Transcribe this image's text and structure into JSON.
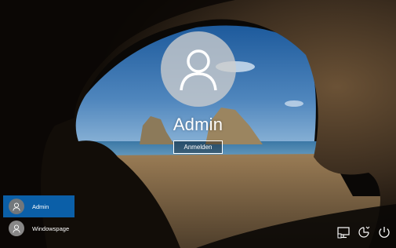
{
  "user": {
    "name": "Admin",
    "sign_in_label": "Anmelden"
  },
  "user_list": [
    {
      "name": "Admin",
      "selected": true
    },
    {
      "name": "Windowspage",
      "selected": false
    }
  ],
  "system_icons": [
    "network-icon",
    "ease-of-access-icon",
    "power-icon"
  ],
  "colors": {
    "selection": "#0b5fa8",
    "text": "#ffffff"
  }
}
